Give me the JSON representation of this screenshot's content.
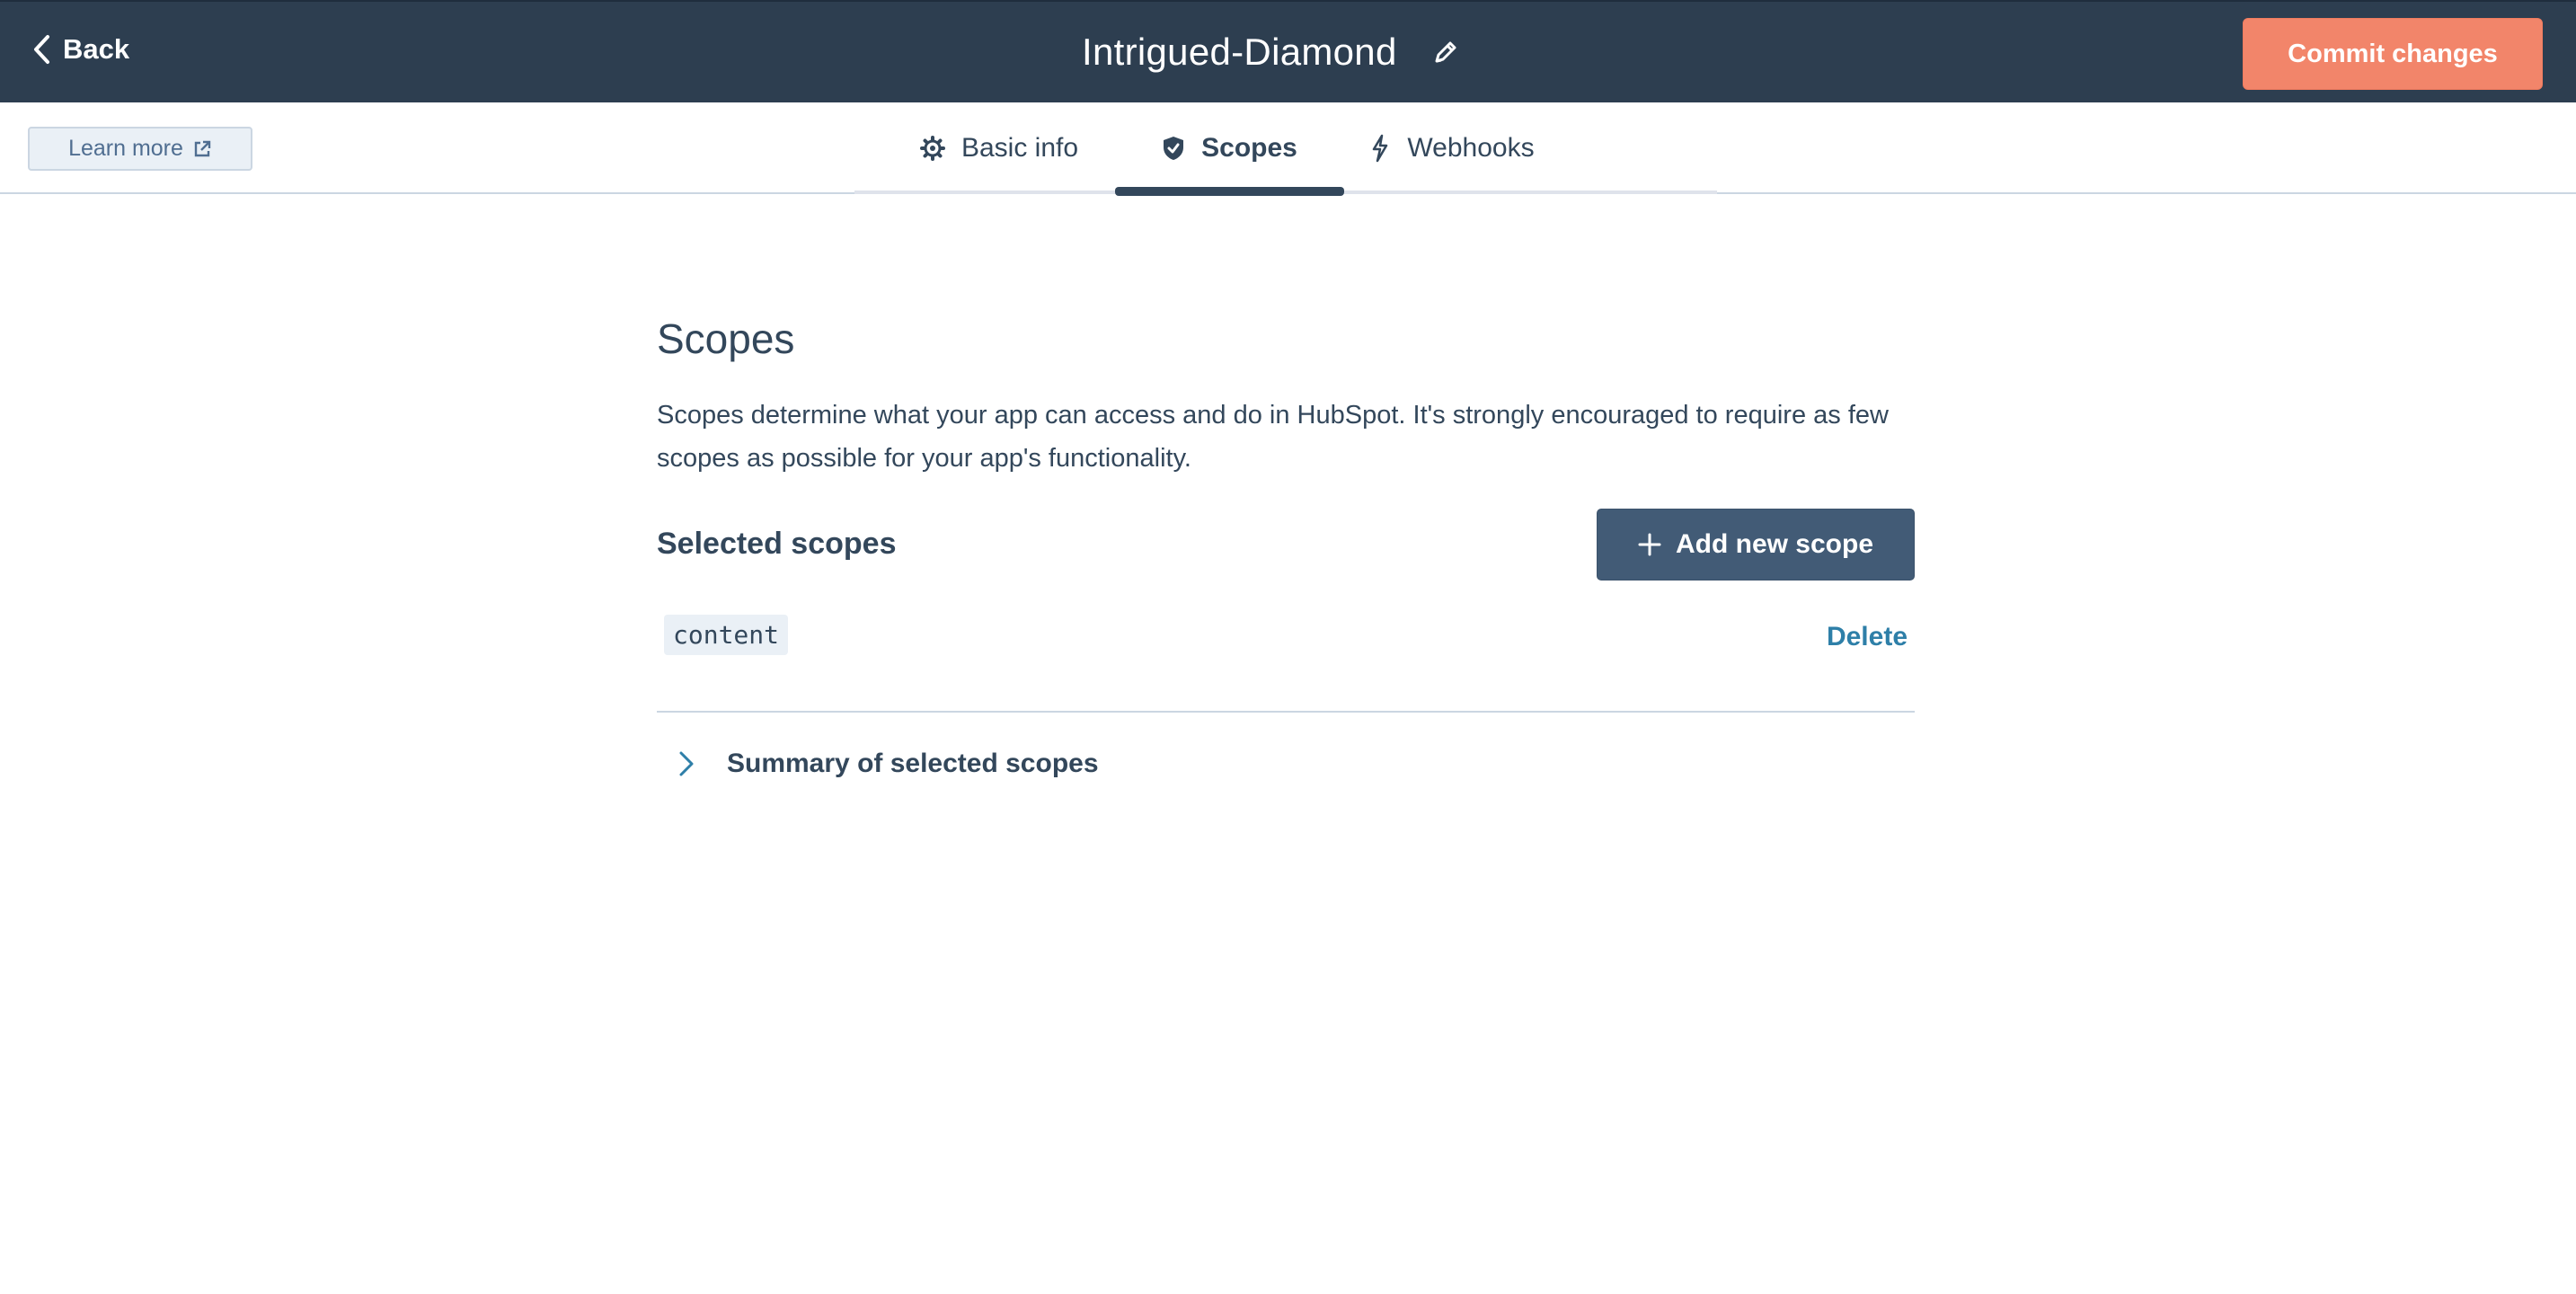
{
  "header": {
    "back_label": "Back",
    "app_name": "Intrigued-Diamond",
    "commit_label": "Commit changes"
  },
  "subbar": {
    "learn_more_label": "Learn more",
    "tabs": [
      {
        "label": "Basic info",
        "icon": "gear-icon",
        "active": false
      },
      {
        "label": "Scopes",
        "icon": "shield-check-icon",
        "active": true
      },
      {
        "label": "Webhooks",
        "icon": "lightning-icon",
        "active": false
      }
    ]
  },
  "main": {
    "title": "Scopes",
    "description": "Scopes determine what your app can access and do in HubSpot. It's strongly encouraged to require as few scopes as possible for your app's functionality.",
    "selected_title": "Selected scopes",
    "add_scope_label": "Add new scope",
    "scopes": [
      {
        "name": "content",
        "action": "Delete"
      }
    ],
    "summary_label": "Summary of selected scopes"
  },
  "colors": {
    "header_bg": "#2d3e50",
    "accent_orange": "#f2856a",
    "primary_button": "#425b76",
    "link": "#2e7fa8",
    "text": "#33475b"
  }
}
